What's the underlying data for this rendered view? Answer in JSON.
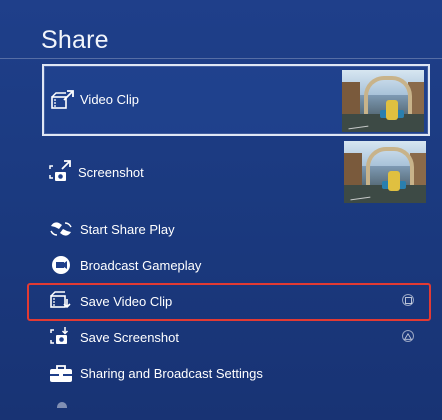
{
  "page": {
    "title": "Share"
  },
  "share_menu": {
    "video_clip": {
      "label": "Video Clip",
      "icon": "video-clip-share-icon",
      "selected": true
    },
    "screenshot": {
      "label": "Screenshot",
      "icon": "screenshot-share-icon"
    },
    "items": [
      {
        "label": "Start Share Play",
        "icon": "share-play-icon"
      },
      {
        "label": "Broadcast Gameplay",
        "icon": "broadcast-icon"
      },
      {
        "label": "Save Video Clip",
        "icon": "save-video-clip-icon",
        "button_hint": "square-button-icon",
        "highlighted": true
      },
      {
        "label": "Save Screenshot",
        "icon": "save-screenshot-icon",
        "button_hint": "triangle-button-icon"
      },
      {
        "label": "Sharing and Broadcast Settings",
        "icon": "toolbox-settings-icon"
      }
    ]
  },
  "colors": {
    "background": "#1f3f8a",
    "selection_border": "#dfe6f4",
    "annotation_highlight": "#e23a33"
  }
}
